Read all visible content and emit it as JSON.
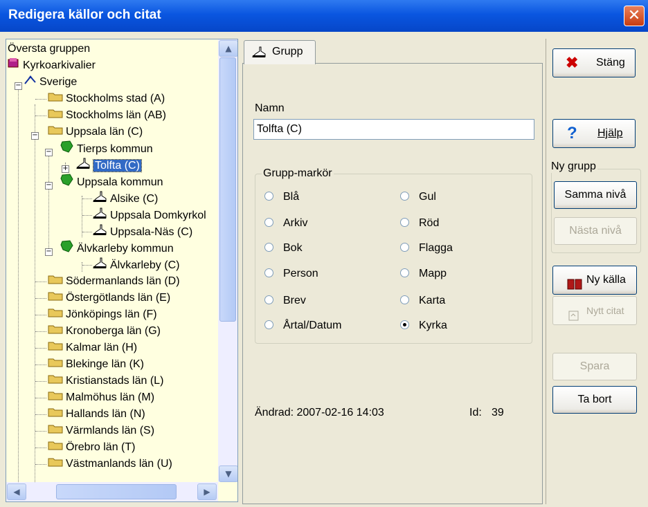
{
  "window": {
    "title": "Redigera källor och citat",
    "close_glyph": "✕"
  },
  "tree": {
    "items": [
      {
        "label": "Översta gruppen"
      },
      {
        "label": "Kyrkoarkivalier"
      },
      {
        "label": "Sverige"
      },
      {
        "label": "Stockholms stad (A)"
      },
      {
        "label": "Stockholms län (AB)"
      },
      {
        "label": "Uppsala län (C)"
      },
      {
        "label": "Tierps kommun"
      },
      {
        "label": "Tolfta (C)"
      },
      {
        "label": "Uppsala kommun"
      },
      {
        "label": "Alsike (C)"
      },
      {
        "label": "Uppsala Domkyrkol"
      },
      {
        "label": "Uppsala-Näs (C)"
      },
      {
        "label": "Älvkarleby kommun"
      },
      {
        "label": "Älvkarleby (C)"
      },
      {
        "label": "Södermanlands län (D)"
      },
      {
        "label": "Östergötlands län (E)"
      },
      {
        "label": "Jönköpings län (F)"
      },
      {
        "label": "Kronoberga län (G)"
      },
      {
        "label": "Kalmar län (H)"
      },
      {
        "label": "Blekinge län (K)"
      },
      {
        "label": "Kristianstads län (L)"
      },
      {
        "label": "Malmöhus län (M)"
      },
      {
        "label": "Hallands län (N)"
      },
      {
        "label": "Värmlands län (S)"
      },
      {
        "label": "Örebro län (T)"
      },
      {
        "label": "Västmanlands län (U)"
      }
    ]
  },
  "tab": {
    "label": "Grupp"
  },
  "form": {
    "name_label": "Namn",
    "name_value": "Tolfta (C)",
    "marker_group_label": "Grupp-markör",
    "markers_left": [
      "Blå",
      "Arkiv",
      "Bok",
      "Person",
      "Brev",
      "Årtal/Datum"
    ],
    "markers_right": [
      "Gul",
      "Röd",
      "Flagga",
      "Mapp",
      "Karta",
      "Kyrka"
    ],
    "selected_marker": "Kyrka",
    "changed": "Ändrad: 2007-02-16 14:03",
    "id_label": "Id:",
    "id_value": "39"
  },
  "buttons": {
    "close": "Stäng",
    "help": "Hjälp",
    "new_group_label": "Ny grupp",
    "same_level": "Samma nivå",
    "next_level": "Nästa nivå",
    "new_source": "Ny källa",
    "new_quote": "Nytt citat",
    "save": "Spara",
    "delete": "Ta bort"
  },
  "colors": {
    "titlebar": "#0a56e0",
    "tree_bg": "#ffffe0",
    "selection": "#316ac5",
    "folder": "#e8c85a",
    "municipality": "#2aa02a"
  }
}
